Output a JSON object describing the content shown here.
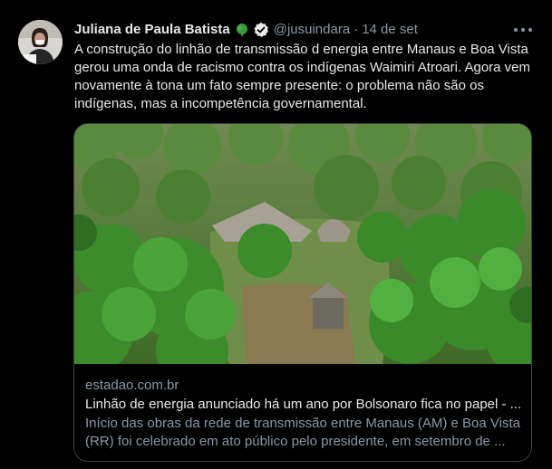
{
  "tweet": {
    "author_name": "Juliana de Paula Batista",
    "handle": "@jusuindara",
    "separator": "·",
    "date": "14 de set",
    "text": "A construção do linhão de transmissão d energia entre Manaus e Boa Vista gerou uma onda de racismo contra os indígenas Waimiri Atroari. Agora vem novamente à tona um fato sempre presente: o problema não são os indígenas, mas a incompetência governamental.",
    "emoji_icon": "tree-icon",
    "verified_icon": "verified-badge-icon",
    "more_icon": "more-options-icon"
  },
  "card": {
    "domain": "estadao.com.br",
    "title": "Linhão de energia anunciado há um ano por Bolsonaro fica no papel - ...",
    "description": "Início das obras da rede de transmissão entre Manaus (AM) e Boa Vista (RR) foi celebrado em ato público pelo presidente, em setembro de ..."
  },
  "colors": {
    "background": "#000000",
    "text_primary": "#e7e9ea",
    "text_secondary": "#8b98a5",
    "card_border": "#3b4147"
  }
}
